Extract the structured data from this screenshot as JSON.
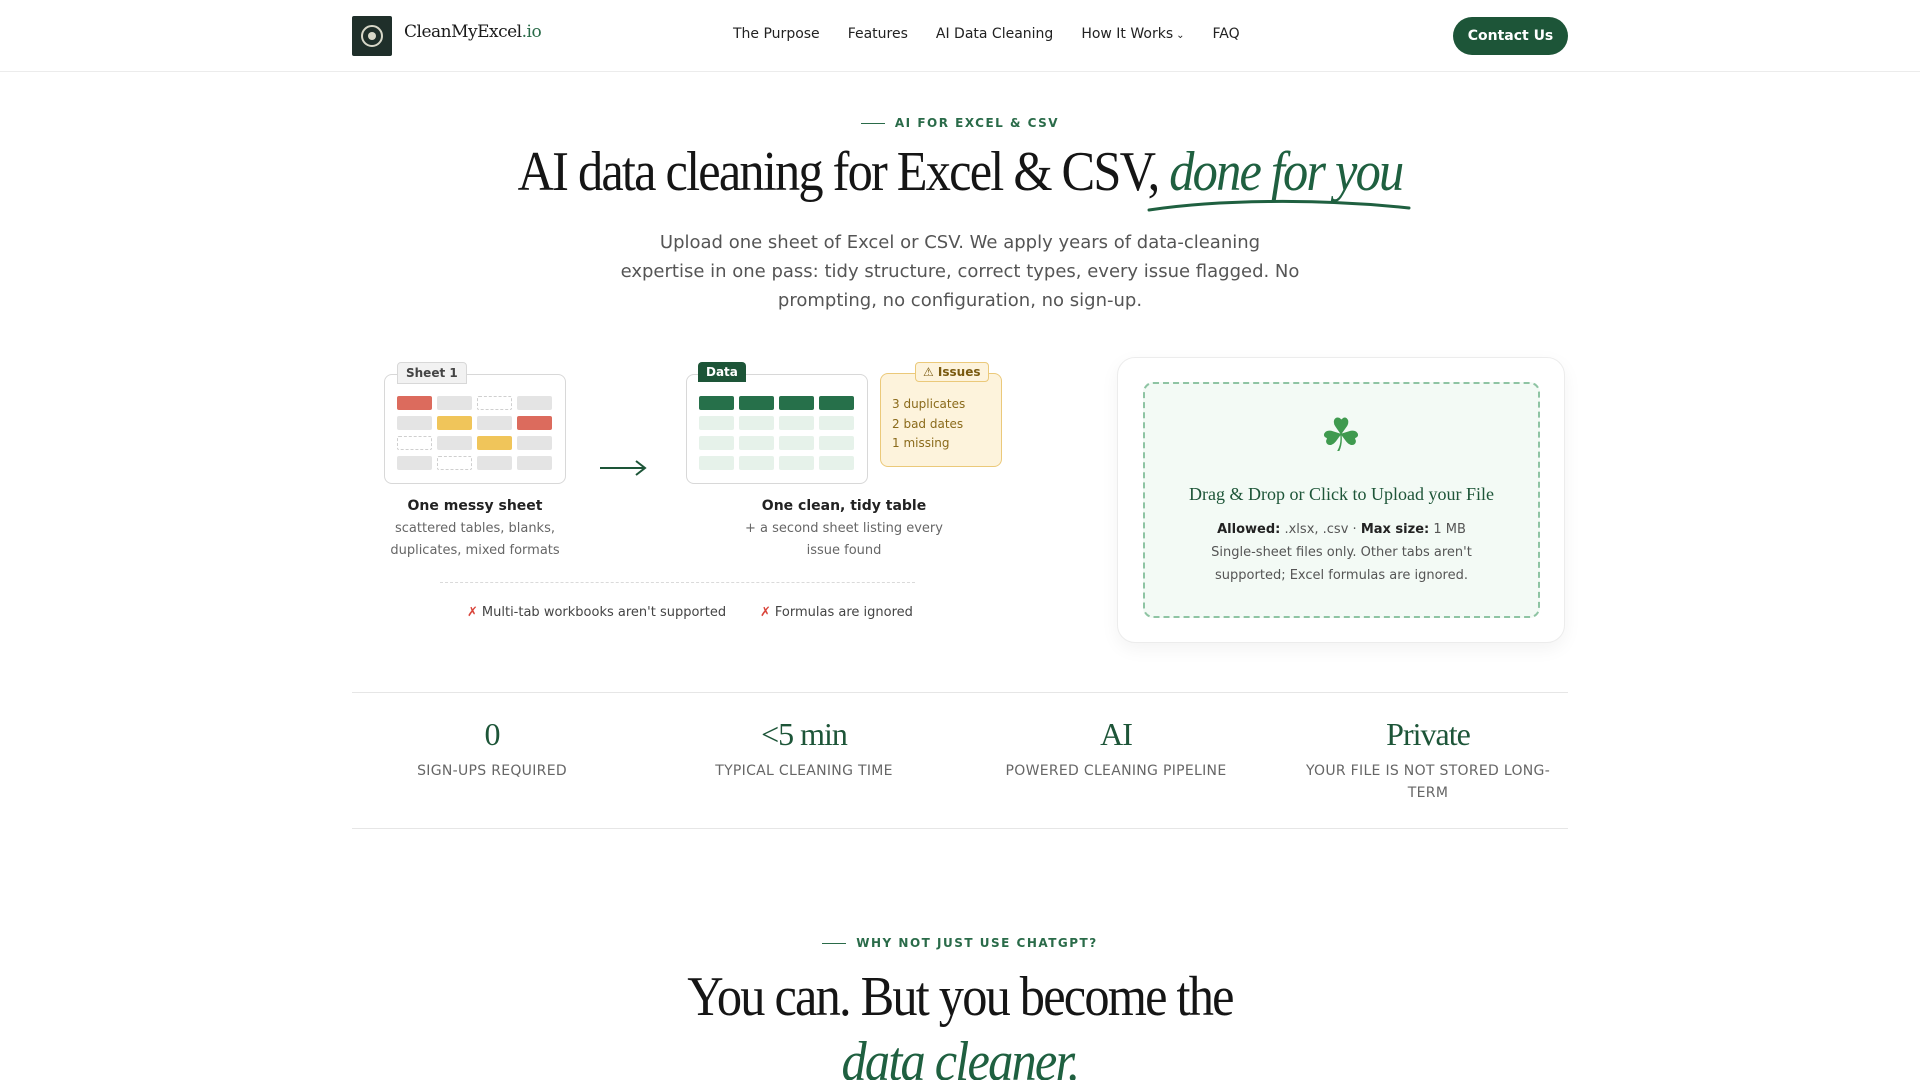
{
  "nav": {
    "logo_name": "CleanMyExcel",
    "logo_tld": ".io",
    "links": [
      "The Purpose",
      "Features",
      "AI Data Cleaning",
      "How It Works",
      "FAQ"
    ],
    "contact_label": "Contact Us"
  },
  "hero": {
    "eyebrow": "AI FOR EXCEL & CSV",
    "title_main": "AI data cleaning for Excel & CSV,",
    "title_em": "done for you",
    "subtitle": "Upload one sheet of Excel or CSV. We apply years of data-cleaning expertise in one pass: tidy structure, correct types, every issue flagged. No prompting, no configuration, no sign-up."
  },
  "illustration": {
    "messy_tab": "Sheet 1",
    "messy_title": "One messy sheet",
    "messy_sub_1": "scattered tables, blanks,",
    "messy_sub_2": "duplicates, mixed formats",
    "clean_tab": "Data",
    "clean_title": "One clean, tidy table",
    "clean_sub_1": "+ a second sheet listing every",
    "clean_sub_2": "issue found",
    "issues_tag": "⚠ Issues",
    "issues": [
      "3 duplicates",
      "2 bad dates",
      "1 missing"
    ],
    "warn_1": "Multi-tab workbooks aren't supported",
    "warn_2": "Formulas are ignored"
  },
  "upload": {
    "title": "Drag & Drop or Click to Upload your File",
    "allowed_label": "Allowed:",
    "allowed_value": ".xlsx, .csv ·",
    "max_label": "Max size:",
    "max_value": "1 MB",
    "note_1": "Single-sheet files only. Other tabs aren't",
    "note_2": "supported; Excel formulas are ignored."
  },
  "stats": [
    {
      "value": "0",
      "label": "SIGN-UPS REQUIRED"
    },
    {
      "value": "<5 min",
      "label": "TYPICAL CLEANING TIME"
    },
    {
      "value": "AI",
      "label": "POWERED CLEANING PIPELINE"
    },
    {
      "value": "Private",
      "label": "YOUR FILE IS NOT STORED LONG-TERM"
    }
  ],
  "section2": {
    "eyebrow": "WHY NOT JUST USE CHATGPT?",
    "title": "You can. But you become the",
    "title_em": "data cleaner."
  },
  "colors": {
    "brand": "#1d5538",
    "accent": "#2a6b49",
    "error": "#dc6b5d",
    "warning": "#f0c55a"
  },
  "icons": [
    "excel-logo-icon",
    "chevron-down-icon",
    "arrow-right-icon",
    "warning-icon",
    "cross-icon",
    "clover-icon"
  ]
}
